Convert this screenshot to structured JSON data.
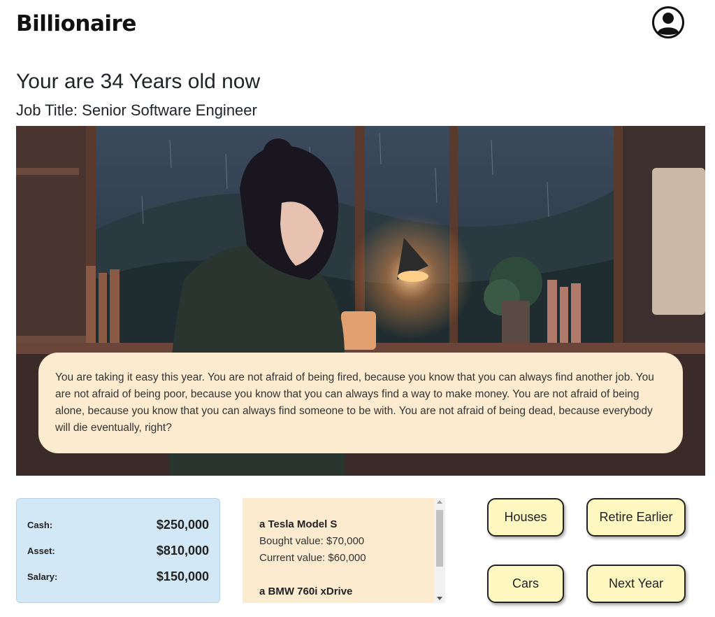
{
  "header": {
    "brand": "Billionaire",
    "profile_icon": "user-circle-icon"
  },
  "status": {
    "age_line": "Your are 34 Years old now",
    "job_line": "Job Title: Senior Software Engineer"
  },
  "scene": {
    "description_icon": "rainy-window-study-illustration"
  },
  "story": {
    "text": "You are taking it easy this year. You are not afraid of being fired, because you know that you can always find another job. You are not afraid of being poor, because you know that you can always find a way to make money. You are not afraid of being alone, because you know that you can always find someone to be with. You are not afraid of being dead, because everybody will die eventually, right?"
  },
  "stats": {
    "cash_label": "Cash:",
    "cash_value": "$250,000",
    "asset_label": "Asset:",
    "asset_value": "$810,000",
    "salary_label": "Salary:",
    "salary_value": "$150,000"
  },
  "cars": [
    {
      "name": "a Tesla Model S",
      "bought": "Bought value: $70,000",
      "current": "Current value: $60,000"
    },
    {
      "name": "a BMW 760i xDrive"
    }
  ],
  "actions": {
    "houses": "Houses",
    "retire": "Retire Earlier",
    "cars": "Cars",
    "next_year": "Next Year"
  },
  "colors": {
    "story_bg": "#fdebd0",
    "stats_bg": "#d3e8f6",
    "button_bg": "#fef7c0"
  }
}
